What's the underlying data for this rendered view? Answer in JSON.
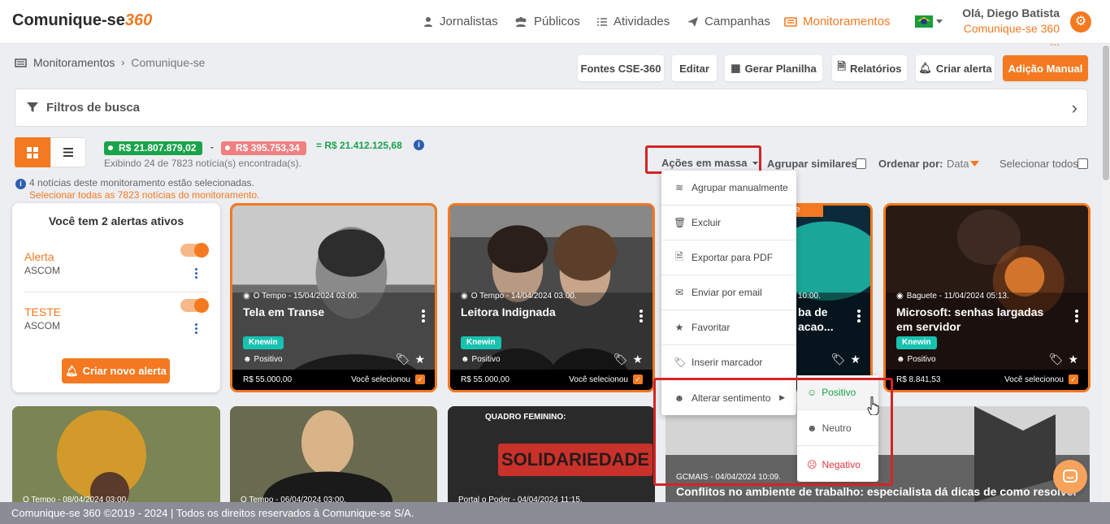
{
  "brand": {
    "name": "Comunique-se",
    "suffix": "360"
  },
  "nav": [
    {
      "label": "Jornalistas",
      "icon": "person-icon"
    },
    {
      "label": "Públicos",
      "icon": "users-icon"
    },
    {
      "label": "Atividades",
      "icon": "list-icon"
    },
    {
      "label": "Campanhas",
      "icon": "send-icon"
    },
    {
      "label": "Monitoramentos",
      "icon": "newspaper-icon",
      "active": true
    }
  ],
  "user": {
    "greeting": "Olá, Diego Batista",
    "company": "Comunique-se 360 ..."
  },
  "breadcrumb": {
    "root": "Monitoramentos",
    "current": "Comunique-se"
  },
  "toolbar": {
    "fontes": "Fontes CSE-360",
    "editar": "Editar",
    "planilha": "Gerar Planilha",
    "relatorios": "Relatórios",
    "alerta": "Criar alerta",
    "adicao": "Adição Manual"
  },
  "filters": {
    "title": "Filtros de busca"
  },
  "summary": {
    "positive": "R$ 21.807.879,02",
    "minus": "-",
    "negative": "R$ 395.753,34",
    "equals": "= R$ 21.412.125,68",
    "showing": "Exibindo 24 de 7823 notícia(s) encontrada(s).",
    "selected": "4 notícias deste monitoramento estão selecionadas.",
    "select_all_link": "Selecionar todas as 7823 notícias do monitoramento."
  },
  "controls": {
    "acoes": "Ações em massa",
    "agrupar": "Agrupar similares",
    "ordenar": "Ordenar por:",
    "ordenar_val": "Data",
    "selecionar": "Selecionar todos"
  },
  "alerts": {
    "title": "Você tem 2 alertas ativos",
    "items": [
      {
        "name": "Alerta",
        "sub": "ASCOM"
      },
      {
        "name": "TESTE",
        "sub": "ASCOM"
      }
    ],
    "new_button": "Criar novo alerta"
  },
  "cards": [
    {
      "source": "O Tempo - 15/04/2024 03:00.",
      "title": "Tela em Transe",
      "tag": "Knewin",
      "sentiment": "Positivo",
      "value": "R$ 55.000,00",
      "selected": "Você selecionou"
    },
    {
      "source": "O Tempo - 14/04/2024 03:00.",
      "title": "Leitora Indignada",
      "tag": "Knewin",
      "sentiment": "Positivo",
      "value": "R$ 55.000,00",
      "selected": "Você selecionou"
    },
    {
      "source": "10:00.",
      "title": "ba de\nacao...",
      "badge": "mente"
    },
    {
      "source": "Baguete - 11/04/2024 05:13.",
      "title": "Microsoft: senhas largadas em servidor",
      "tag": "Knewin",
      "sentiment": "Positivo",
      "value": "R$ 8.841,53",
      "selected": "Você selecionou"
    }
  ],
  "row2": [
    {
      "source": "O Tempo - 08/04/2024 03:00."
    },
    {
      "source": "O Tempo - 06/04/2024 03:00."
    },
    {
      "source": "Portal o Poder - 04/04/2024 11:15.",
      "banner_top": "QUADRO FEMININO:",
      "banner_main": "SOLIDARIEDADE"
    },
    {
      "source": "GCMAIS - 04/04/2024 10:09.",
      "title": "Conflitos no ambiente de trabalho: especialista dá dicas de como resolver"
    }
  ],
  "menu": [
    "Agrupar manualmente",
    "Excluir",
    "Exportar para PDF",
    "Enviar por email",
    "Favoritar",
    "Inserir marcador",
    "Alterar sentimento"
  ],
  "sentiment_menu": [
    {
      "label": "Positivo",
      "color": "#1aa34a"
    },
    {
      "label": "Neutro",
      "color": "#555555"
    },
    {
      "label": "Negativo",
      "color": "#e0353c"
    }
  ],
  "footer": "Comunique-se 360 ©2019 - 2024 | Todos os direitos reservados à Comunique-se S/A."
}
